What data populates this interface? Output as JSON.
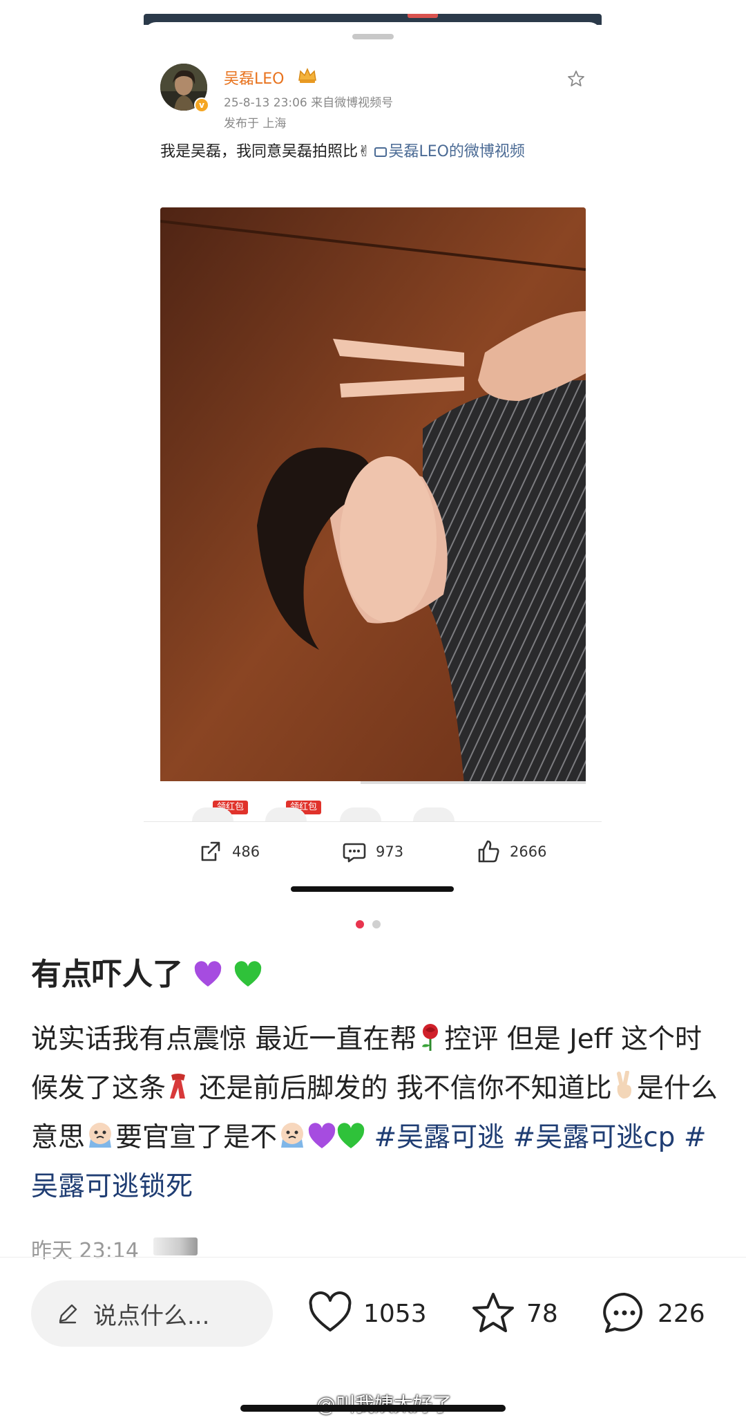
{
  "embedded_post": {
    "username": "吴磊LEO",
    "time_source": "25-8-13 23:06  来自微博视频号",
    "location": "发布于 上海",
    "text": "我是吴磊，我同意吴磊拍照比✌",
    "video_link": "吴磊LEO的微博视频",
    "red_packet_label": "领红包",
    "actions": {
      "repost": "486",
      "comment": "973",
      "like": "2666"
    },
    "icons": [
      "crown-icon",
      "star-icon",
      "repost-icon",
      "comment-icon",
      "like-icon"
    ]
  },
  "carousel": {
    "count": 2,
    "active": 1
  },
  "note": {
    "title": "有点吓人了",
    "body_plain_1": "说实话我有点震惊 最近一直在帮",
    "body_plain_2": "控评 但是 Jeff 这个时候发了这条",
    "body_plain_3": " 还是前后脚发的 我不信你不知道比",
    "body_plain_4": "是什么意思",
    "body_plain_5": "要官宣了是不",
    "tags": [
      "#吴露可逃",
      "#吴露可逃cp",
      "#吴露可逃锁死"
    ],
    "time": "昨天 23:14"
  },
  "bottom_bar": {
    "comment_placeholder": "说点什么...",
    "likes": "1053",
    "favorites": "78",
    "comments": "226"
  },
  "watermark": "@叫我姨太好了",
  "colors": {
    "accent_red": "#e8344e",
    "username_orange": "#e8731e",
    "tag_blue": "#1f3d73",
    "link_blue": "#4a6a94"
  }
}
